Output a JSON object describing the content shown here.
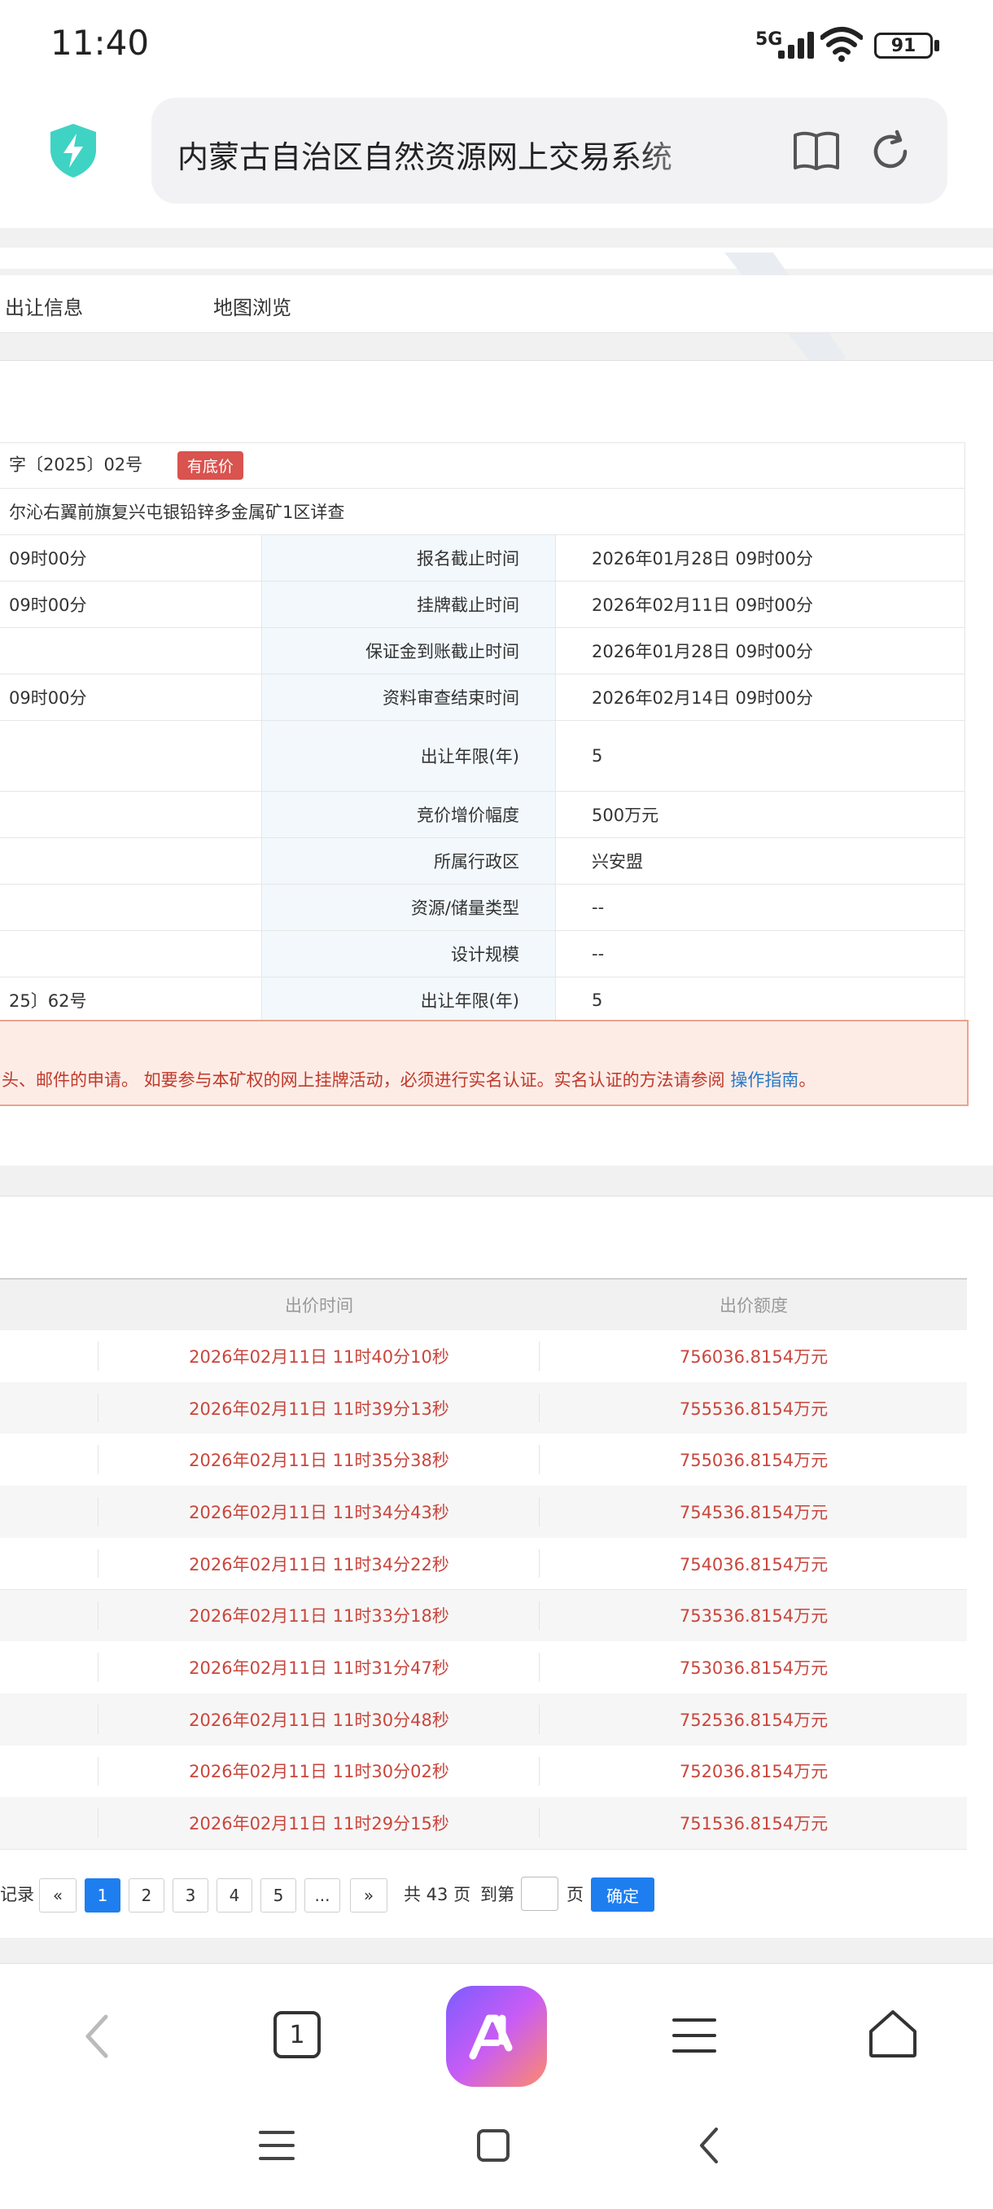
{
  "status_bar": {
    "time": "11:40",
    "network": "5G",
    "battery": "91"
  },
  "browser": {
    "url_title": "内蒙古自治区自然资源网上交易系统"
  },
  "site_nav": {
    "items": [
      "出让信息",
      "地图浏览"
    ]
  },
  "project": {
    "doc_no": "字〔2025〕02号",
    "badge": "有底价",
    "name": "尔沁右翼前旗复兴屯银铅锌多金属矿1区详查",
    "rows": [
      {
        "left": "09时00分",
        "label": "报名截止时间",
        "value": "2026年01月28日 09时00分"
      },
      {
        "left": "09时00分",
        "label": "挂牌截止时间",
        "value": "2026年02月11日 09时00分"
      },
      {
        "left": "",
        "label": "保证金到账截止时间",
        "value": "2026年01月28日 09时00分"
      },
      {
        "left": "09时00分",
        "label": "资料审查结束时间",
        "value": "2026年02月14日 09时00分"
      },
      {
        "left": "",
        "label": "出让年限(年)",
        "value": "5"
      },
      {
        "left": "",
        "label": "竞价增价幅度",
        "value": "500万元"
      },
      {
        "left": "",
        "label": "所属行政区",
        "value": "兴安盟"
      },
      {
        "left": "",
        "label": "资源/储量类型",
        "value": "--"
      },
      {
        "left": "",
        "label": "设计规模",
        "value": "--"
      },
      {
        "left": "25〕62号",
        "label": "出让年限(年)",
        "value": "5"
      }
    ]
  },
  "notice": {
    "text": "头、邮件的申请。 如要参与本矿权的网上挂牌活动，必须进行实名认证。实名认证的方法请参阅 ",
    "link": "操作指南",
    "end": "。"
  },
  "bids": {
    "headers": {
      "time": "出价时间",
      "amount": "出价额度"
    },
    "rows": [
      {
        "time": "2026年02月11日 11时40分10秒",
        "amount": "756036.8154万元"
      },
      {
        "time": "2026年02月11日 11时39分13秒",
        "amount": "755536.8154万元"
      },
      {
        "time": "2026年02月11日 11时35分38秒",
        "amount": "755036.8154万元"
      },
      {
        "time": "2026年02月11日 11时34分43秒",
        "amount": "754536.8154万元"
      },
      {
        "time": "2026年02月11日 11时34分22秒",
        "amount": "754036.8154万元"
      },
      {
        "time": "2026年02月11日 11时33分18秒",
        "amount": "753536.8154万元"
      },
      {
        "time": "2026年02月11日 11时31分47秒",
        "amount": "753036.8154万元"
      },
      {
        "time": "2026年02月11日 11时30分48秒",
        "amount": "752536.8154万元"
      },
      {
        "time": "2026年02月11日 11时30分02秒",
        "amount": "752036.8154万元"
      },
      {
        "time": "2026年02月11日 11时29分15秒",
        "amount": "751536.8154万元"
      }
    ]
  },
  "pagination": {
    "prefix": "记录",
    "prev": "«",
    "pages": [
      "1",
      "2",
      "3",
      "4",
      "5",
      "..."
    ],
    "next": "»",
    "total": "共 43 页",
    "goto_label": "到第",
    "page_suffix": "页",
    "confirm": "确定"
  },
  "bottom_toolbar": {
    "tab_count": "1"
  },
  "colors": {
    "accent": "#1e7ef0",
    "bid_red": "#c9463d",
    "badge_red": "#d9534f",
    "shield": "#3fd3c4"
  }
}
